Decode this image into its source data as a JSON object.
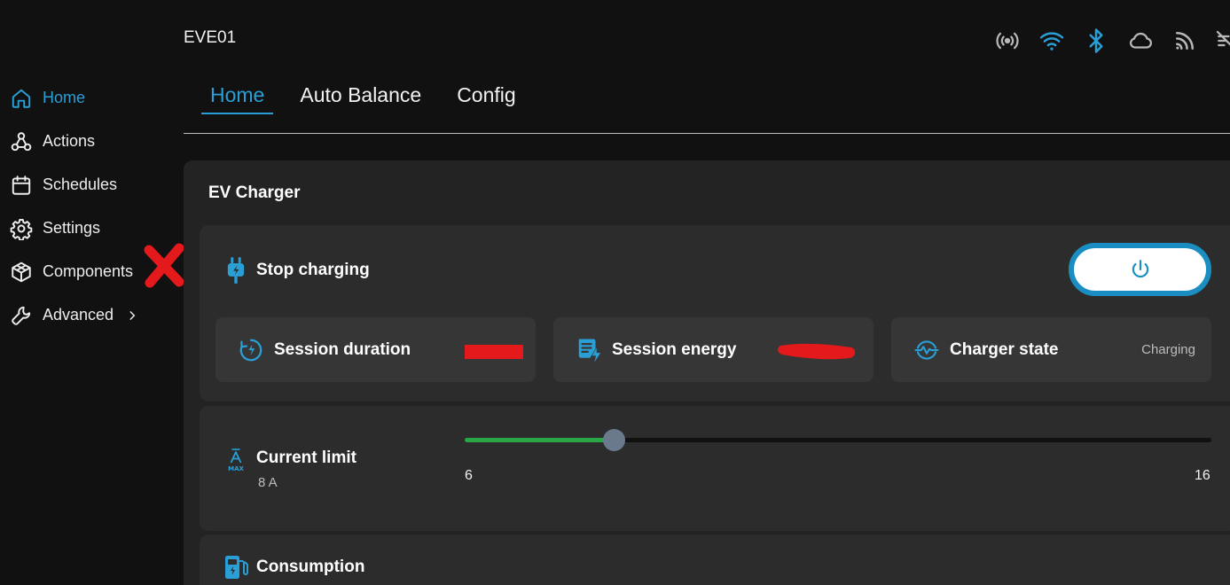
{
  "header": {
    "device_name": "EVE01"
  },
  "status_icons": [
    "broadcast-icon",
    "wifi-icon",
    "bluetooth-icon",
    "cloud-icon",
    "rss-icon",
    "sim-icon"
  ],
  "sidebar": {
    "items": [
      {
        "label": "Home",
        "icon": "home-icon",
        "active": true
      },
      {
        "label": "Actions",
        "icon": "webhook-icon"
      },
      {
        "label": "Schedules",
        "icon": "calendar-icon"
      },
      {
        "label": "Settings",
        "icon": "gear-icon"
      },
      {
        "label": "Components",
        "icon": "cube-icon"
      },
      {
        "label": "Advanced",
        "icon": "wrench-icon",
        "has_submenu": true
      }
    ]
  },
  "tabs": [
    {
      "label": "Home",
      "active": true
    },
    {
      "label": "Auto Balance"
    },
    {
      "label": "Config"
    }
  ],
  "panel": {
    "title": "EV Charger",
    "charging": {
      "label": "Stop charging",
      "tiles": [
        {
          "label": "Session duration",
          "value": ""
        },
        {
          "label": "Session energy",
          "value": ""
        },
        {
          "label": "Charger state",
          "value": "Charging"
        }
      ]
    },
    "current_limit": {
      "label": "Current limit",
      "value_text": "8 A",
      "min": "6",
      "max": "16",
      "value": 8
    },
    "consumption": {
      "label": "Consumption"
    }
  },
  "colors": {
    "accent": "#2a9fd6",
    "slider_fill": "#29a745",
    "power_border": "#1a8ec2",
    "redaction": "#e4191c"
  }
}
